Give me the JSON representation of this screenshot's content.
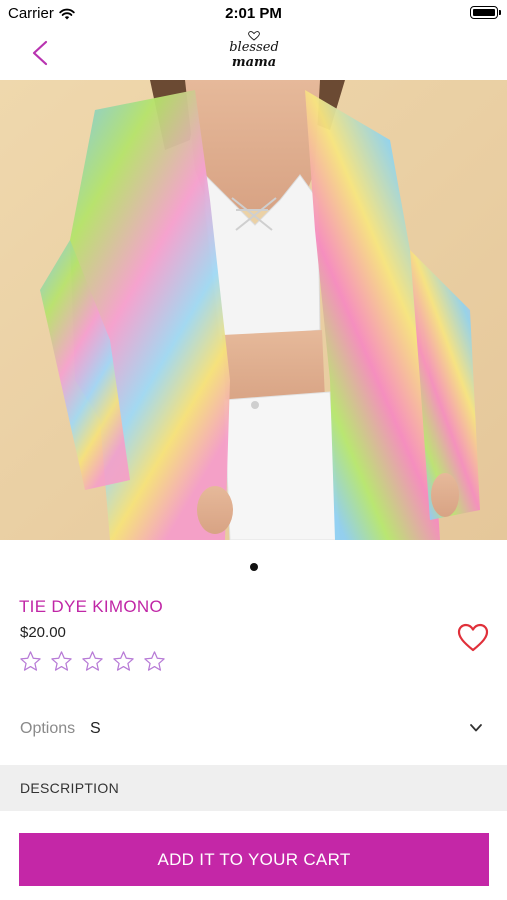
{
  "status_bar": {
    "carrier": "Carrier",
    "time": "2:01 PM",
    "icons": [
      "wifi-icon",
      "battery-icon"
    ]
  },
  "nav": {
    "back_icon": "chevron-left-icon",
    "logo_text": "blessed mama"
  },
  "product": {
    "image_description": "Tie dye kimono on model",
    "pager_count": 1,
    "pager_active": 0,
    "title": "TIE DYE KIMONO",
    "price": "$20.00",
    "rating": 0,
    "rating_max": 5,
    "favorite_icon": "heart-outline-icon"
  },
  "options": {
    "label": "Options",
    "value": "S",
    "icon": "chevron-down-icon"
  },
  "description": {
    "label": "DESCRIPTION"
  },
  "cart": {
    "button_label": "ADD IT TO YOUR CART"
  },
  "colors": {
    "accent": "#c427a7",
    "title": "#c026a6",
    "heart": "#e0303a",
    "star_outline": "#b77ad6"
  }
}
